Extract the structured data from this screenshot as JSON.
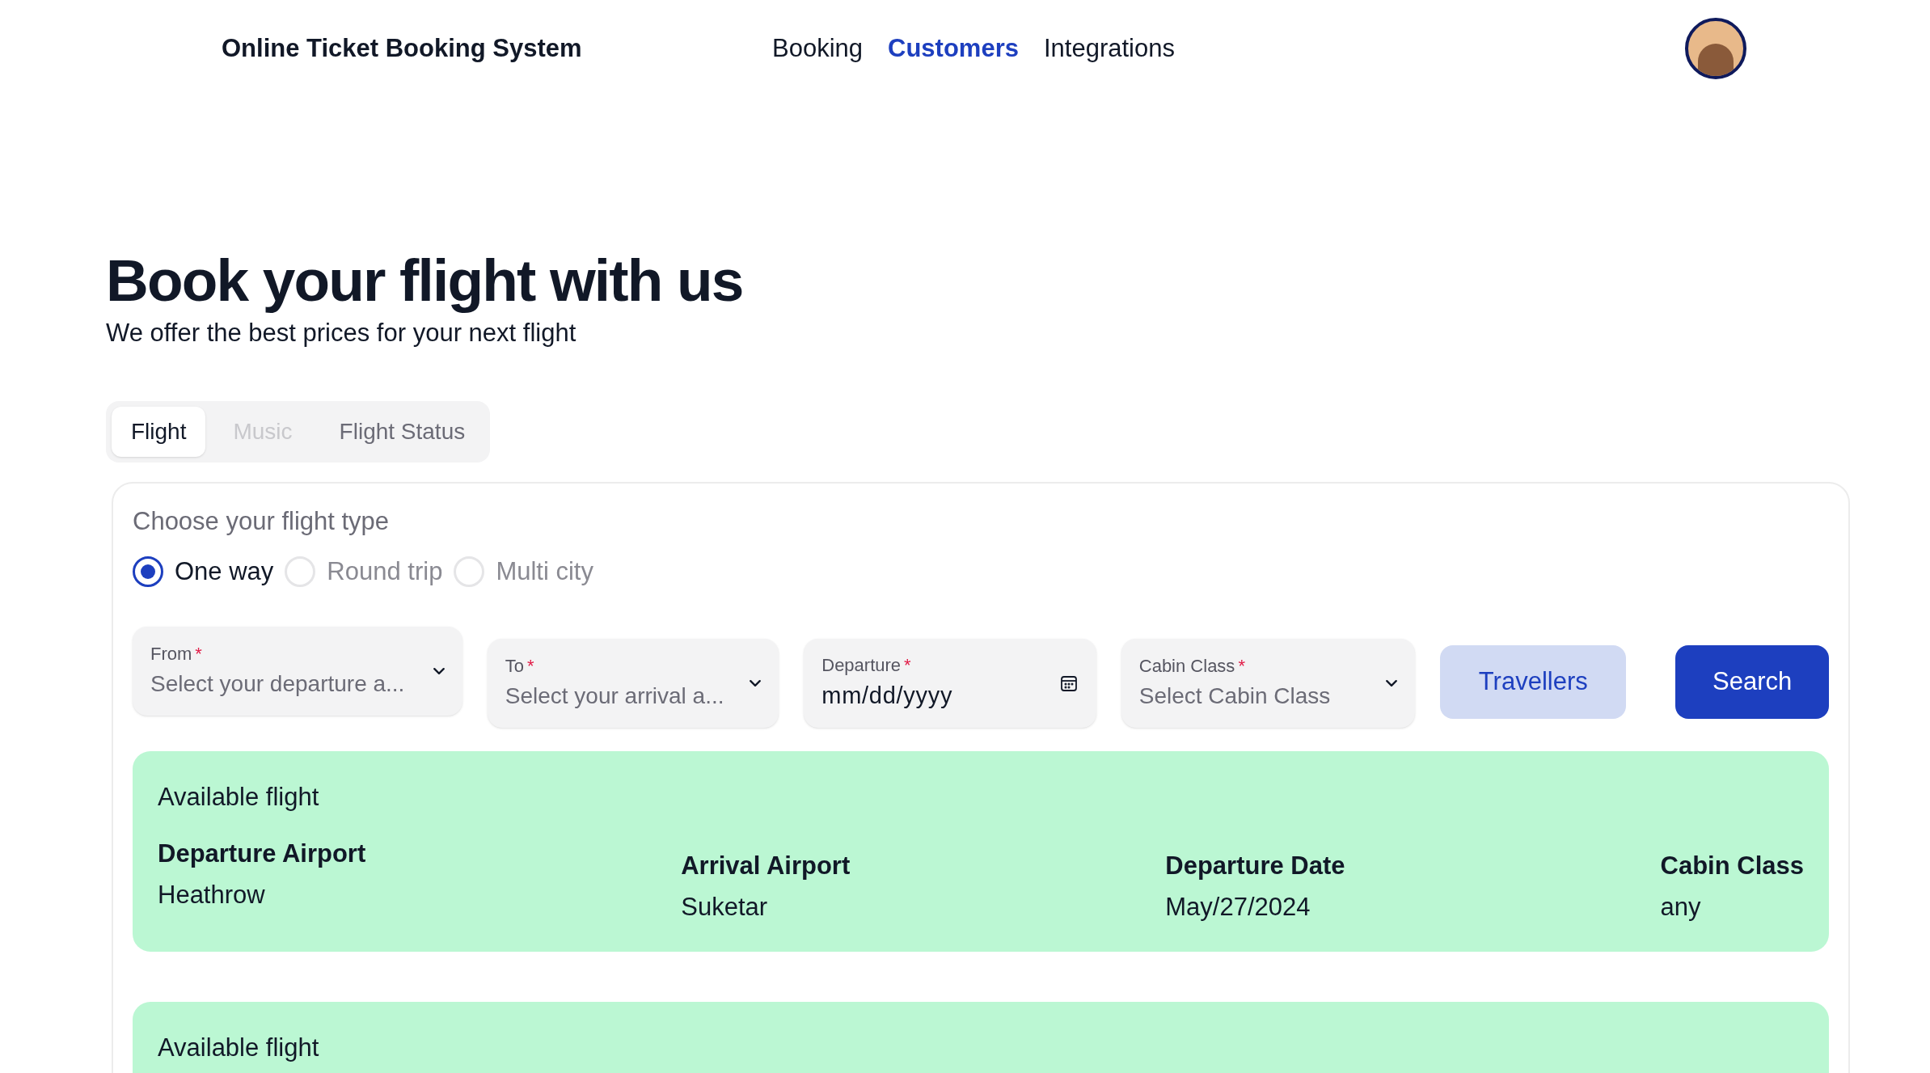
{
  "header": {
    "title": "Online Ticket Booking System",
    "nav": [
      {
        "label": "Booking",
        "selected": false
      },
      {
        "label": "Customers",
        "selected": true
      },
      {
        "label": "Integrations",
        "selected": false
      }
    ]
  },
  "hero": {
    "title": "Book your flight with us",
    "subtitle": "We offer the best prices for your next flight"
  },
  "tabs": [
    {
      "label": "Flight",
      "selected": true,
      "disabled": false
    },
    {
      "label": "Music",
      "selected": false,
      "disabled": true
    },
    {
      "label": "Flight Status",
      "selected": false,
      "disabled": false
    }
  ],
  "form": {
    "flight_type_label": "Choose your flight type",
    "flight_types": [
      {
        "label": "One way",
        "selected": true
      },
      {
        "label": "Round trip",
        "selected": false
      },
      {
        "label": "Multi city",
        "selected": false
      }
    ],
    "fields": [
      {
        "kind": "select",
        "label": "From",
        "required_mark": "*",
        "placeholder": "Select your departure a..."
      },
      {
        "kind": "select",
        "label": "To",
        "required_mark": "*",
        "placeholder": "Select your arrival a..."
      },
      {
        "kind": "date",
        "label": "Departure",
        "required_mark": "*",
        "value": "mm/dd/yyyy"
      },
      {
        "kind": "select",
        "label": "Cabin Class",
        "required_mark": "*",
        "placeholder": "Select Cabin Class"
      }
    ],
    "buttons": [
      {
        "label": "Travellers",
        "kind": "secondary"
      },
      {
        "label": "Search",
        "kind": "primary"
      }
    ]
  },
  "results": [
    {
      "title": "Available flight",
      "columns": [
        {
          "label": "Departure Airport",
          "value": "Heathrow"
        },
        {
          "label": "Arrival Airport",
          "value": "Suketar"
        },
        {
          "label": "Departure Date",
          "value": "May/27/2024"
        },
        {
          "label": "Cabin Class",
          "value": "any"
        }
      ]
    },
    {
      "title": "Available flight"
    }
  ]
}
